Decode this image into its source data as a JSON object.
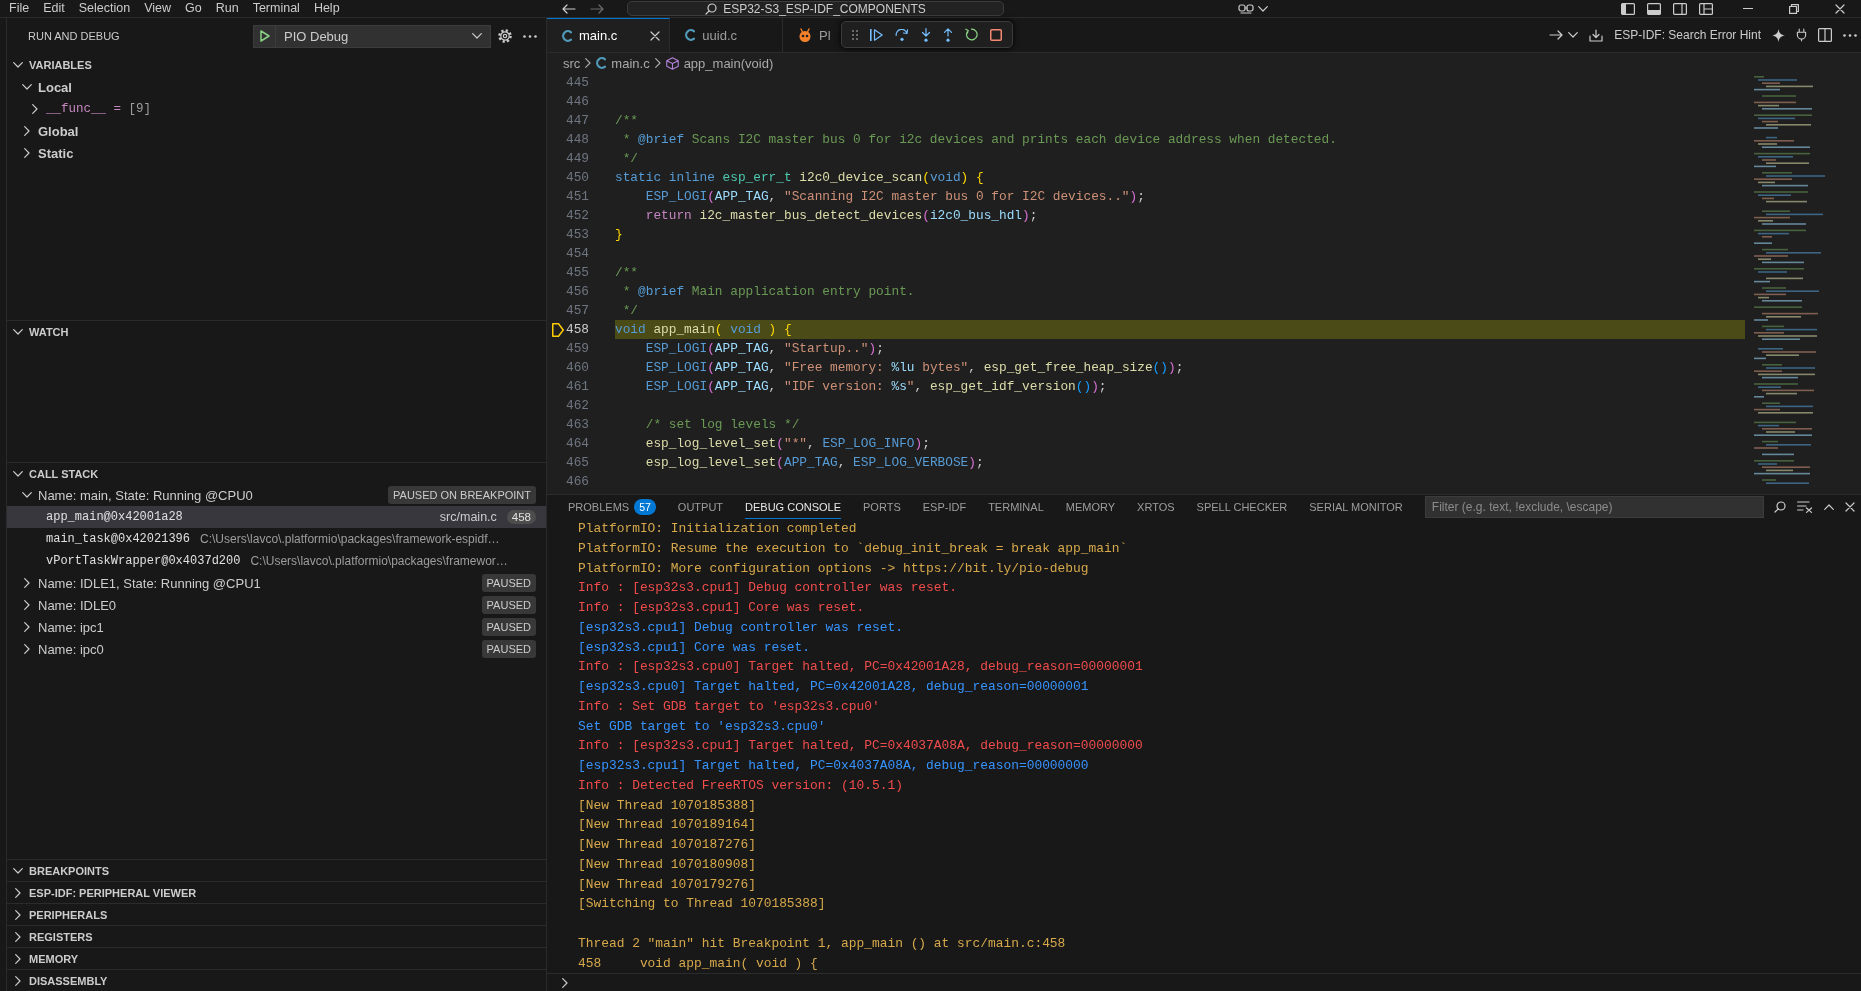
{
  "title_bar": {
    "menu": [
      "File",
      "Edit",
      "Selection",
      "View",
      "Go",
      "Run",
      "Terminal",
      "Help"
    ],
    "command_center": "ESP32-S3_ESP-IDF_COMPONENTS"
  },
  "sidebar": {
    "title": "RUN AND DEBUG",
    "launch_config": "PIO Debug",
    "variables": {
      "title": "VARIABLES",
      "expanded": true,
      "scopes": [
        {
          "name": "Local",
          "expanded": true,
          "children": [
            {
              "name": "__func__",
              "separator": "=",
              "value": "[9]",
              "expanded": false
            }
          ]
        },
        {
          "name": "Global",
          "expanded": false
        },
        {
          "name": "Static",
          "expanded": false
        }
      ]
    },
    "watch": {
      "title": "WATCH",
      "expanded": true
    },
    "call_stack": {
      "title": "CALL STACK",
      "expanded": true,
      "threads": [
        {
          "name": "Name: main, State: Running @CPU0",
          "status": "PAUSED ON BREAKPOINT",
          "expanded": true,
          "frames": [
            {
              "function": "app_main@0x42001a28",
              "source": "src/main.c",
              "line": "458",
              "selected": true
            },
            {
              "function": "main_task@0x42021396",
              "source": "C:\\Users\\lavco\\.platformio\\packages\\framework-espidf…",
              "selected": false
            },
            {
              "function": "vPortTaskWrapper@0x4037d200",
              "source": "C:\\Users\\lavco\\.platformio\\packages\\framewor…",
              "selected": false
            }
          ]
        },
        {
          "name": "Name: IDLE1, State: Running @CPU1",
          "status": "PAUSED",
          "expanded": false
        },
        {
          "name": "Name: IDLE0",
          "status": "PAUSED",
          "expanded": false
        },
        {
          "name": "Name: ipc1",
          "status": "PAUSED",
          "expanded": false
        },
        {
          "name": "Name: ipc0",
          "status": "PAUSED",
          "expanded": false
        }
      ]
    },
    "other_sections": [
      {
        "title": "BREAKPOINTS",
        "expanded": true
      },
      {
        "title": "ESP-IDF: PERIPHERAL VIEWER",
        "expanded": false
      },
      {
        "title": "PERIPHERALS",
        "expanded": false
      },
      {
        "title": "REGISTERS",
        "expanded": false
      },
      {
        "title": "MEMORY",
        "expanded": false
      },
      {
        "title": "DISASSEMBLY",
        "expanded": false
      }
    ]
  },
  "editor": {
    "tabs": [
      {
        "label": "main.c",
        "kind": "c",
        "selected": true
      },
      {
        "label": "uuid.c",
        "kind": "c",
        "selected": false
      },
      {
        "label": "Pl",
        "kind": "platformio",
        "selected": false
      }
    ],
    "action": "ESP-IDF: Search Error Hint",
    "breadcrumb": [
      {
        "label": "src",
        "kind": "folder"
      },
      {
        "label": "main.c",
        "kind": "c"
      },
      {
        "label": "app_main(void)",
        "kind": "function"
      }
    ],
    "lines": [
      {
        "number": "445",
        "current": false
      },
      {
        "number": "446",
        "current": false
      },
      {
        "number": "447",
        "current": false,
        "tokens": [
          {
            "kind": "comment",
            "text": "/**"
          }
        ]
      },
      {
        "number": "448",
        "current": false,
        "tokens": [
          {
            "kind": "comment",
            "text": " * "
          },
          {
            "kind": "doctag",
            "text": "@brief"
          },
          {
            "kind": "comment",
            "text": " Scans I2C master bus 0 for i2c devices and prints each device address when detected."
          }
        ]
      },
      {
        "number": "449",
        "current": false,
        "tokens": [
          {
            "kind": "comment",
            "text": " */"
          }
        ]
      },
      {
        "number": "450",
        "current": false,
        "tokens": [
          {
            "kind": "keyword",
            "text": "static "
          },
          {
            "kind": "keyword",
            "text": "inline "
          },
          {
            "kind": "type",
            "text": "esp_err_t "
          },
          {
            "kind": "function",
            "text": "i2c0_device_scan"
          },
          {
            "kind": "bracket1",
            "text": "("
          },
          {
            "kind": "keyword",
            "text": "void"
          },
          {
            "kind": "bracket1",
            "text": ") "
          },
          {
            "kind": "bracket1",
            "text": "{"
          }
        ]
      },
      {
        "number": "451",
        "current": false,
        "tokens": [
          {
            "kind": "macro",
            "text": "    ESP_LOGI"
          },
          {
            "kind": "bracket2",
            "text": "("
          },
          {
            "kind": "variable",
            "text": "APP_TAG"
          },
          {
            "kind": "plain",
            "text": ", "
          },
          {
            "kind": "string",
            "text": "\"Scanning I2C master bus 0 for I2C devices..\""
          },
          {
            "kind": "bracket2",
            "text": ")"
          },
          {
            "kind": "plain",
            "text": ";"
          }
        ]
      },
      {
        "number": "452",
        "current": false,
        "tokens": [
          {
            "kind": "control",
            "text": "    return "
          },
          {
            "kind": "function",
            "text": "i2c_master_bus_detect_devices"
          },
          {
            "kind": "bracket2",
            "text": "("
          },
          {
            "kind": "variable",
            "text": "i2c0_bus_hdl"
          },
          {
            "kind": "bracket2",
            "text": ")"
          },
          {
            "kind": "plain",
            "text": ";"
          }
        ]
      },
      {
        "number": "453",
        "current": false,
        "tokens": [
          {
            "kind": "bracket1",
            "text": "}"
          }
        ]
      },
      {
        "number": "454",
        "current": false
      },
      {
        "number": "455",
        "current": false,
        "tokens": [
          {
            "kind": "comment",
            "text": "/**"
          }
        ]
      },
      {
        "number": "456",
        "current": false,
        "tokens": [
          {
            "kind": "comment",
            "text": " * "
          },
          {
            "kind": "doctag",
            "text": "@brief"
          },
          {
            "kind": "comment",
            "text": " Main application entry point."
          }
        ]
      },
      {
        "number": "457",
        "current": false,
        "tokens": [
          {
            "kind": "comment",
            "text": " */"
          }
        ]
      },
      {
        "number": "458",
        "current": true,
        "tokens": [
          {
            "kind": "keyword",
            "text": "void "
          },
          {
            "kind": "function",
            "text": "app_main"
          },
          {
            "kind": "bracket1",
            "text": "( "
          },
          {
            "kind": "keyword",
            "text": "void "
          },
          {
            "kind": "bracket1",
            "text": ") "
          },
          {
            "kind": "bracket1",
            "text": "{"
          }
        ]
      },
      {
        "number": "459",
        "current": false,
        "tokens": [
          {
            "kind": "macro",
            "text": "    ESP_LOGI"
          },
          {
            "kind": "bracket2",
            "text": "("
          },
          {
            "kind": "variable",
            "text": "APP_TAG"
          },
          {
            "kind": "plain",
            "text": ", "
          },
          {
            "kind": "string",
            "text": "\"Startup..\""
          },
          {
            "kind": "bracket2",
            "text": ")"
          },
          {
            "kind": "plain",
            "text": ";"
          }
        ]
      },
      {
        "number": "460",
        "current": false,
        "tokens": [
          {
            "kind": "macro",
            "text": "    ESP_LOGI"
          },
          {
            "kind": "bracket2",
            "text": "("
          },
          {
            "kind": "variable",
            "text": "APP_TAG"
          },
          {
            "kind": "plain",
            "text": ", "
          },
          {
            "kind": "string",
            "text": "\"Free memory: "
          },
          {
            "kind": "format",
            "text": "%lu"
          },
          {
            "kind": "string",
            "text": " bytes\""
          },
          {
            "kind": "plain",
            "text": ", "
          },
          {
            "kind": "function",
            "text": "esp_get_free_heap_size"
          },
          {
            "kind": "bracket3",
            "text": "()"
          },
          {
            "kind": "bracket2",
            "text": ")"
          },
          {
            "kind": "plain",
            "text": ";"
          }
        ]
      },
      {
        "number": "461",
        "current": false,
        "tokens": [
          {
            "kind": "macro",
            "text": "    ESP_LOGI"
          },
          {
            "kind": "bracket2",
            "text": "("
          },
          {
            "kind": "variable",
            "text": "APP_TAG"
          },
          {
            "kind": "plain",
            "text": ", "
          },
          {
            "kind": "string",
            "text": "\"IDF version: "
          },
          {
            "kind": "format",
            "text": "%s"
          },
          {
            "kind": "string",
            "text": "\""
          },
          {
            "kind": "plain",
            "text": ", "
          },
          {
            "kind": "function",
            "text": "esp_get_idf_version"
          },
          {
            "kind": "bracket3",
            "text": "()"
          },
          {
            "kind": "bracket2",
            "text": ")"
          },
          {
            "kind": "plain",
            "text": ";"
          }
        ]
      },
      {
        "number": "462",
        "current": false
      },
      {
        "number": "463",
        "current": false,
        "tokens": [
          {
            "kind": "comment",
            "text": "    /* set log levels */"
          }
        ]
      },
      {
        "number": "464",
        "current": false,
        "tokens": [
          {
            "kind": "function",
            "text": "    esp_log_level_set"
          },
          {
            "kind": "bracket2",
            "text": "("
          },
          {
            "kind": "string",
            "text": "\"*\""
          },
          {
            "kind": "plain",
            "text": ", "
          },
          {
            "kind": "macro",
            "text": "ESP_LOG_INFO"
          },
          {
            "kind": "bracket2",
            "text": ")"
          },
          {
            "kind": "plain",
            "text": ";"
          }
        ]
      },
      {
        "number": "465",
        "current": false,
        "tokens": [
          {
            "kind": "function",
            "text": "    esp_log_level_set"
          },
          {
            "kind": "bracket2",
            "text": "("
          },
          {
            "kind": "macro",
            "text": "APP_TAG"
          },
          {
            "kind": "plain",
            "text": ", "
          },
          {
            "kind": "macro",
            "text": "ESP_LOG_VERBOSE"
          },
          {
            "kind": "bracket2",
            "text": ")"
          },
          {
            "kind": "plain",
            "text": ";"
          }
        ]
      },
      {
        "number": "466",
        "current": false
      }
    ]
  },
  "panel": {
    "tabs": [
      {
        "label": "PROBLEMS",
        "badge": "57",
        "selected": false
      },
      {
        "label": "OUTPUT",
        "selected": false
      },
      {
        "label": "DEBUG CONSOLE",
        "selected": true
      },
      {
        "label": "PORTS",
        "selected": false
      },
      {
        "label": "ESP-IDF",
        "selected": false
      },
      {
        "label": "TERMINAL",
        "selected": false
      },
      {
        "label": "MEMORY",
        "selected": false
      },
      {
        "label": "XRTOS",
        "selected": false
      },
      {
        "label": "SPELL CHECKER",
        "selected": false
      },
      {
        "label": "SERIAL MONITOR",
        "selected": false
      }
    ],
    "filter": {
      "placeholder": "Filter (e.g. text, !exclude, \\escape)"
    },
    "console": [
      {
        "kind": "output",
        "text": "PlatformIO: Initialization completed"
      },
      {
        "kind": "output",
        "text": "PlatformIO: Resume the execution to `debug_init_break = break app_main`"
      },
      {
        "kind": "output",
        "text": "PlatformIO: More configuration options -> https://bit.ly/pio-debug"
      },
      {
        "kind": "error",
        "text": "Info : [esp32s3.cpu1] Debug controller was reset."
      },
      {
        "kind": "error",
        "text": "Info : [esp32s3.cpu1] Core was reset."
      },
      {
        "kind": "info",
        "text": "[esp32s3.cpu1] Debug controller was reset."
      },
      {
        "kind": "info",
        "text": "[esp32s3.cpu1] Core was reset."
      },
      {
        "kind": "error",
        "text": "Info : [esp32s3.cpu0] Target halted, PC=0x42001A28, debug_reason=00000001"
      },
      {
        "kind": "info",
        "text": "[esp32s3.cpu0] Target halted, PC=0x42001A28, debug_reason=00000001"
      },
      {
        "kind": "error",
        "text": "Info : Set GDB target to 'esp32s3.cpu0'"
      },
      {
        "kind": "info",
        "text": "Set GDB target to 'esp32s3.cpu0'"
      },
      {
        "kind": "error",
        "text": "Info : [esp32s3.cpu1] Target halted, PC=0x4037A08A, debug_reason=00000000"
      },
      {
        "kind": "info",
        "text": "[esp32s3.cpu1] Target halted, PC=0x4037A08A, debug_reason=00000000"
      },
      {
        "kind": "error",
        "text": "Info : Detected FreeRTOS version: (10.5.1)"
      },
      {
        "kind": "output",
        "text": "[New Thread 1070185388]"
      },
      {
        "kind": "output",
        "text": "[New Thread 1070189164]"
      },
      {
        "kind": "output",
        "text": "[New Thread 1070187276]"
      },
      {
        "kind": "output",
        "text": "[New Thread 1070180908]"
      },
      {
        "kind": "output",
        "text": "[New Thread 1070179276]"
      },
      {
        "kind": "output",
        "text": "[Switching to Thread 1070185388]"
      },
      {
        "kind": "blank"
      },
      {
        "kind": "output",
        "text": "Thread 2 \"main\" hit Breakpoint 1, app_main () at src/main.c:458"
      },
      {
        "kind": "output",
        "text": "458     void app_main( void ) {"
      }
    ]
  }
}
